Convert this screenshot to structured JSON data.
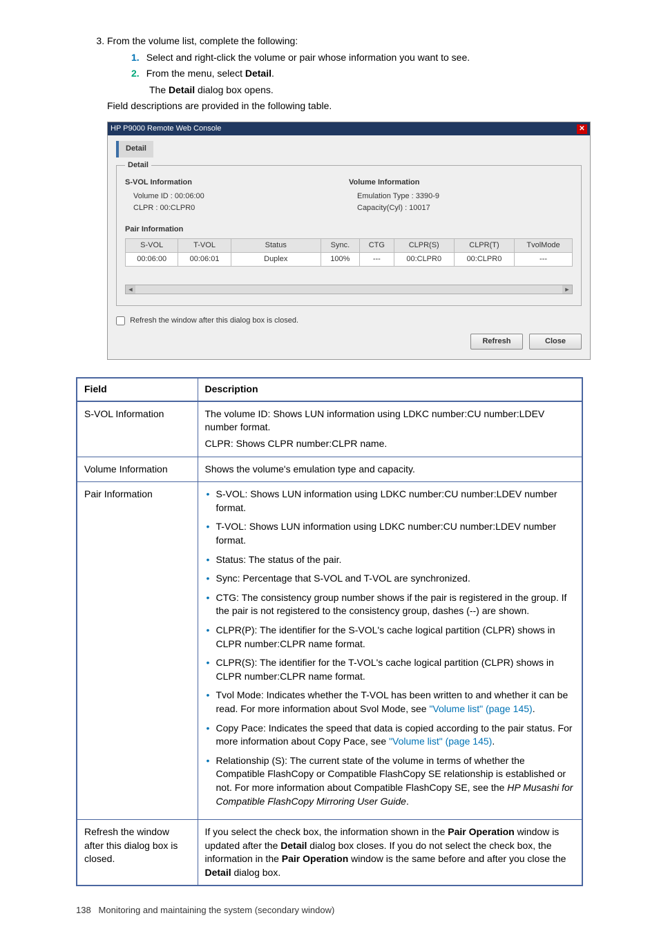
{
  "intro": {
    "step3": "From the volume list, complete the following:",
    "sub1_num": "1.",
    "sub1_text": "Select and right-click the volume or pair whose information you want to see.",
    "sub2_num": "2.",
    "sub2_pre": "From the menu, select ",
    "sub2_bold": "Detail",
    "sub2_post": ".",
    "sub2_result_pre": "The ",
    "sub2_result_bold": "Detail",
    "sub2_result_post": " dialog box opens.",
    "field_desc_line": "Field descriptions are provided in the following table."
  },
  "dialog": {
    "titlebar": "HP P9000 Remote Web Console",
    "tab": "Detail",
    "fieldset_legend": "Detail",
    "svol_hdr": "S-VOL Information",
    "svol_vol": "Volume ID : 00:06:00",
    "svol_clpr": "CLPR : 00:CLPR0",
    "vol_hdr": "Volume Information",
    "vol_emul": "Emulation Type : 3390-9",
    "vol_cap": "Capacity(Cyl) : 10017",
    "pair_hdr": "Pair Information",
    "cols": {
      "svol": "S-VOL",
      "tvol": "T-VOL",
      "status": "Status",
      "sync": "Sync.",
      "ctg": "CTG",
      "clprs": "CLPR(S)",
      "clprt": "CLPR(T)",
      "tvolmode": "TvolMode"
    },
    "row": {
      "svol": "00:06:00",
      "tvol": "00:06:01",
      "status": "Duplex",
      "sync": "100%",
      "ctg": "---",
      "clprs": "00:CLPR0",
      "clprt": "00:CLPR0",
      "tvolmode": "---"
    },
    "scroll_left": "◄",
    "scroll_right": "►",
    "checkbox_label": "Refresh the window after this dialog box is closed.",
    "btn_refresh": "Refresh",
    "btn_close": "Close"
  },
  "table": {
    "th_field": "Field",
    "th_desc": "Description",
    "r1f": "S-VOL Information",
    "r1d_l1": "The volume ID: Shows LUN information using LDKC number:CU number:LDEV number format.",
    "r1d_l2": "CLPR: Shows CLPR number:CLPR name.",
    "r2f": "Volume Information",
    "r2d": "Shows the volume's emulation type and capacity.",
    "r3f": "Pair Information",
    "r3b1": "S-VOL: Shows LUN information using LDKC number:CU number:LDEV number format.",
    "r3b2": "T-VOL: Shows LUN information using LDKC number:CU number:LDEV number format.",
    "r3b3": "Status: The status of the pair.",
    "r3b4": "Sync: Percentage that S-VOL and T-VOL are synchronized.",
    "r3b5": "CTG: The consistency group number shows if the pair is registered in the group. If the pair is not registered to the consistency group, dashes (--) are shown.",
    "r3b6": "CLPR(P): The identifier for the S-VOL's cache logical partition (CLPR) shows in CLPR number:CLPR name format.",
    "r3b7": "CLPR(S): The identifier for the T-VOL's cache logical partition (CLPR) shows in CLPR number:CLPR name format.",
    "r3b8_pre": "Tvol Mode: Indicates whether the T-VOL has been written to and whether it can be read. For more information about Svol Mode, see ",
    "r3b8_link": "\"Volume list\" (page 145)",
    "r3b8_post": ".",
    "r3b9_pre": "Copy Pace: Indicates the speed that data is copied according to the pair status. For more information about Copy Pace, see ",
    "r3b9_link": "\"Volume list\" (page 145)",
    "r3b9_post": ".",
    "r3b10_pre": "Relationship (S): The current state of the volume in terms of whether the Compatible FlashCopy or Compatible FlashCopy SE relationship is established or not. For more information about Compatible FlashCopy SE, see the ",
    "r3b10_ital": "HP Musashi for Compatible FlashCopy Mirroring User Guide",
    "r3b10_post": ".",
    "r4f": "Refresh the window after this dialog box is closed.",
    "r4d_pre": "If you select the check box, the information shown in the ",
    "r4d_b1": "Pair Operation",
    "r4d_mid1": " window is updated after the ",
    "r4d_b2": "Detail",
    "r4d_mid2": " dialog box closes. If you do not select the check box, the information in the ",
    "r4d_b3": "Pair Operation",
    "r4d_mid3": " window is the same before and after you close the ",
    "r4d_b4": "Detail",
    "r4d_post": " dialog box."
  },
  "footer": {
    "page": "138",
    "text": "Monitoring and maintaining the system (secondary window)"
  }
}
